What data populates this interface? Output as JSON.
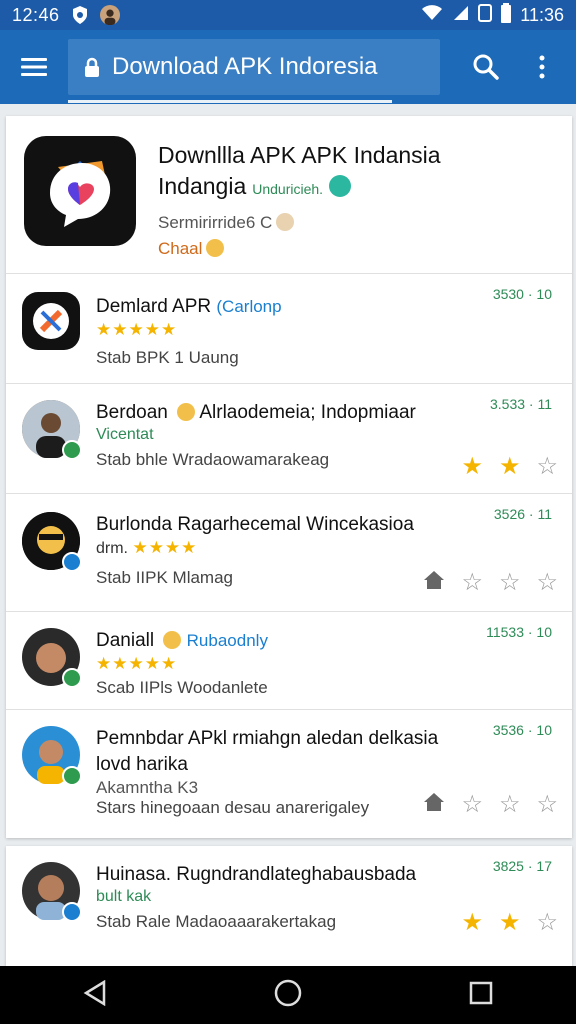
{
  "status": {
    "time_left": "12:46",
    "time_right": "11:36"
  },
  "appbar": {
    "title": "Download APK Indoresia"
  },
  "featured": {
    "title_line1": "Downllla APK APK Indansia",
    "title_line2": "Indangia",
    "title_sub": "Unduricieh.",
    "meta1": "Sermirirride6 C",
    "meta2": "Chaal"
  },
  "rows": [
    {
      "title": "Demlard APR",
      "accent": "(Carlonp",
      "meta": "Stab BPK 1 Uaung",
      "count": "3530 · 10",
      "stars": "★★★★★",
      "green": ""
    },
    {
      "title": "Berdoan",
      "accent": "Alrlaodemeia; Indopmiaar",
      "meta": "Stab bhle Wradaowamarakeag",
      "count": "3.533 · 11",
      "stars": "",
      "green": "Vicentat"
    },
    {
      "title": "Burlonda Ragarhecemal Wincekasioa",
      "accent": "",
      "meta": "Stab IIPK  Mlamag",
      "count": "3526 · 11",
      "stars": "★★★★",
      "green": "drm."
    },
    {
      "title": "Daniall",
      "accent": "Rubaodnly",
      "meta": "Scab IIPls Woodanlete",
      "count": "11533 · 10",
      "stars": "★★★★★",
      "green": ""
    },
    {
      "title": "Pemnbdar APkl rmiahgn aledan delkasia",
      "title2": "lovd harika",
      "accent": "",
      "meta": "Akamntha K3",
      "meta2": "Stars hinegoaan desau anarerigaley",
      "count": "3536 · 10",
      "stars": "",
      "green": ""
    }
  ],
  "card2_row": {
    "title": "Huinasa. Rugndrandlateghabausbada",
    "green": "bult kak",
    "meta": "Stab Rale Madaoaaarakertakag",
    "count": "3825 · 17"
  },
  "colors": {
    "appbar": "#1d6ab8",
    "statusbar": "#1d5aa8",
    "accent": "#1a7fd0",
    "green": "#2e8b57",
    "star": "#f5b400"
  }
}
